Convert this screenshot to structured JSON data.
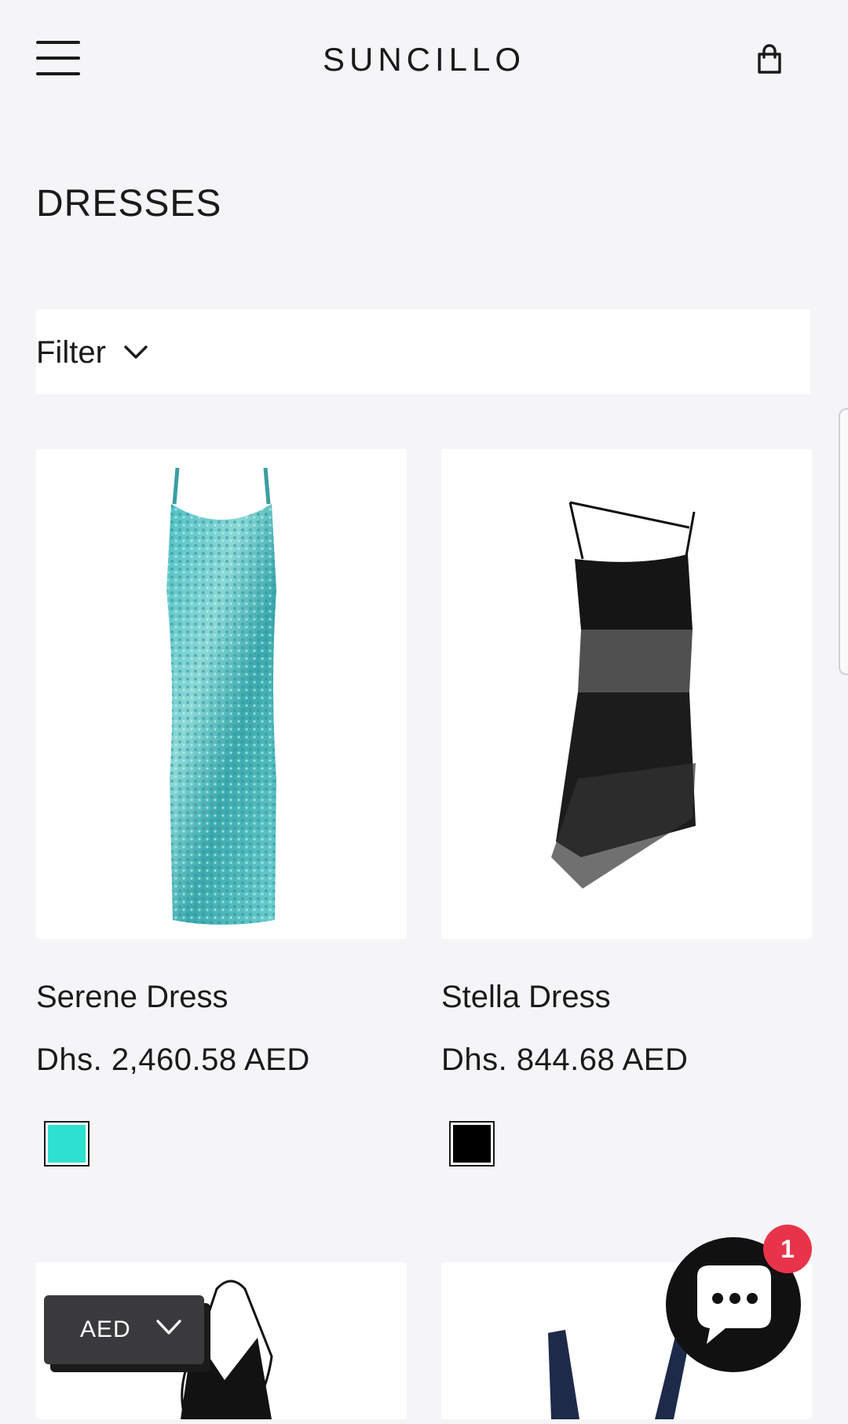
{
  "header": {
    "brand": "SUNCILLO",
    "menu_icon": "hamburger-menu-icon",
    "cart_icon": "shopping-bag-icon"
  },
  "page_title": "DRESSES",
  "filter": {
    "label": "Filter",
    "icon": "chevron-down-icon"
  },
  "products": [
    {
      "name": "Serene Dress",
      "price": "Dhs. 2,460.58 AED",
      "swatch_color": "#2ee0cf"
    },
    {
      "name": "Stella Dress",
      "price": "Dhs. 844.68 AED",
      "swatch_color": "#000000"
    }
  ],
  "currency_selector": {
    "value": "AED",
    "icon": "chevron-down-icon"
  },
  "chat": {
    "icon": "chat-bubble-icon",
    "badge_count": "1"
  },
  "colors": {
    "background": "#f5f5f7",
    "badge": "#e8344a"
  }
}
